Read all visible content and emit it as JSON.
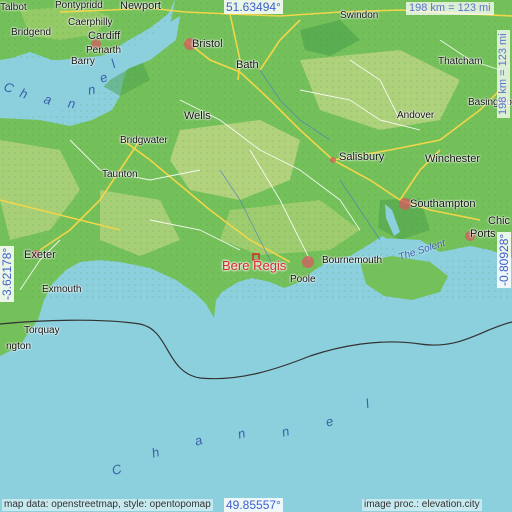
{
  "coords": {
    "north": "51.63494°",
    "south": "49.85557°",
    "west": "-3.62178°",
    "east": "-0.80928°"
  },
  "scale": {
    "top": "198 km = 123 mi",
    "side": "198 km = 123 mi"
  },
  "credits": {
    "left": "map data: openstreetmap, style: opentopomap",
    "right": "image proc.: elevation.city"
  },
  "target": {
    "name": "Bere Regis",
    "color": "#d8262a"
  },
  "places": [
    {
      "key": "talbot",
      "name": "Talbot"
    },
    {
      "key": "pontypridd",
      "name": "Pontypridd"
    },
    {
      "key": "newport",
      "name": "Newport"
    },
    {
      "key": "caerphilly",
      "name": "Caerphilly"
    },
    {
      "key": "bridgend",
      "name": "Bridgend"
    },
    {
      "key": "cardiff",
      "name": "Cardiff"
    },
    {
      "key": "penarth",
      "name": "Penarth"
    },
    {
      "key": "barry",
      "name": "Barry"
    },
    {
      "key": "bristol",
      "name": "Bristol"
    },
    {
      "key": "swindon",
      "name": "Swindon"
    },
    {
      "key": "bath",
      "name": "Bath"
    },
    {
      "key": "thatcham",
      "name": "Thatcham"
    },
    {
      "key": "wells",
      "name": "Wells"
    },
    {
      "key": "basingstoke",
      "name": "Basingsto"
    },
    {
      "key": "andover",
      "name": "Andover"
    },
    {
      "key": "bridgwater",
      "name": "Bridgwater"
    },
    {
      "key": "salisbury",
      "name": "Salisbury"
    },
    {
      "key": "winchester",
      "name": "Winchester"
    },
    {
      "key": "taunton",
      "name": "Taunton"
    },
    {
      "key": "southampton",
      "name": "Southampton"
    },
    {
      "key": "chic",
      "name": "Chic"
    },
    {
      "key": "ports",
      "name": "Ports"
    },
    {
      "key": "exeter",
      "name": "Exeter"
    },
    {
      "key": "bournemouth",
      "name": "Bournemouth"
    },
    {
      "key": "poole",
      "name": "Poole"
    },
    {
      "key": "exmouth",
      "name": "Exmouth"
    },
    {
      "key": "torquay",
      "name": "Torquay"
    },
    {
      "key": "ngton",
      "name": "ngton"
    }
  ],
  "water_labels": {
    "solent": "The Solent",
    "channel_upper": [
      "C",
      "h",
      "a",
      "n",
      "n",
      "e",
      "l"
    ],
    "channel_lower": [
      "C",
      "h",
      "a",
      "n",
      "n",
      "e",
      "l"
    ]
  },
  "colors": {
    "sea": "#8cd0de",
    "lowland": "#74c05a",
    "upland": "#c8d88a",
    "forest": "#4aa04a",
    "road_major": "#f2d64a",
    "road_minor": "#ffffff",
    "text_coord": "#3f5fc8"
  }
}
